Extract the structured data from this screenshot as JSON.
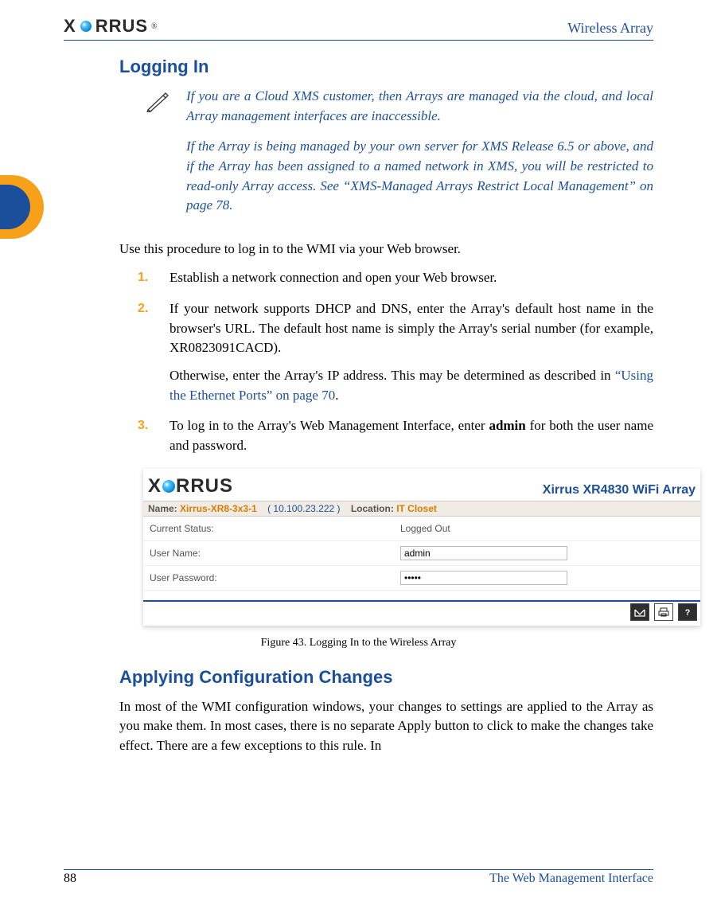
{
  "header": {
    "brand_prefix": "X",
    "brand_suffix": "RRUS",
    "registered": "®",
    "doc_title": "Wireless Array"
  },
  "section1": {
    "title": "Logging In",
    "note_p1": "If you are a Cloud XMS customer, then Arrays are managed via the cloud, and local Array management interfaces are inaccessible.",
    "note_p2": "If the Array is being managed by your own server for XMS Release 6.5 or above, and if the Array has been assigned to a named network in XMS, you will be restricted to read-only Array access. See “XMS-Managed Arrays Restrict Local Management” on page 78.",
    "intro": "Use this procedure to log in to the WMI via your Web browser.",
    "steps": {
      "s1": "Establish a network connection and open your Web browser.",
      "s2a": "If your network supports DHCP and DNS, enter the Array's default host name in the browser's URL. The default host name is simply the Array's serial number (for example, XR0823091CACD).",
      "s2b_pre": "Otherwise, enter the Array's IP address. This may be determined as described in ",
      "s2b_link": "“Using the Ethernet Ports” on page 70",
      "s2b_post": ".",
      "s3_pre": "To log in to the Array's Web Management Interface, enter ",
      "s3_bold": "admin",
      "s3_post": " for both the user name and password."
    }
  },
  "figure": {
    "product_title": "Xirrus XR4830 WiFi Array",
    "name_label": "Name:",
    "name_value": "Xirrus-XR8-3x3-1",
    "ip_value": "( 10.100.23.222 )",
    "location_label": "Location:",
    "location_value": "IT Closet",
    "row_status_label": "Current Status:",
    "row_status_value": "Logged Out",
    "row_user_label": "User Name:",
    "row_user_value": "admin",
    "row_pass_label": "User Password:",
    "row_pass_value": "•••••",
    "caption": "Figure 43. Logging In to the Wireless Array"
  },
  "section2": {
    "title": "Applying Configuration Changes",
    "para": "In most of the WMI configuration windows, your changes to settings are applied to the Array as you make them. In most cases, there is no separate Apply button to click to make the changes take effect. There are a few exceptions to this rule. In"
  },
  "footer": {
    "page_number": "88",
    "chapter": "The Web Management Interface"
  }
}
